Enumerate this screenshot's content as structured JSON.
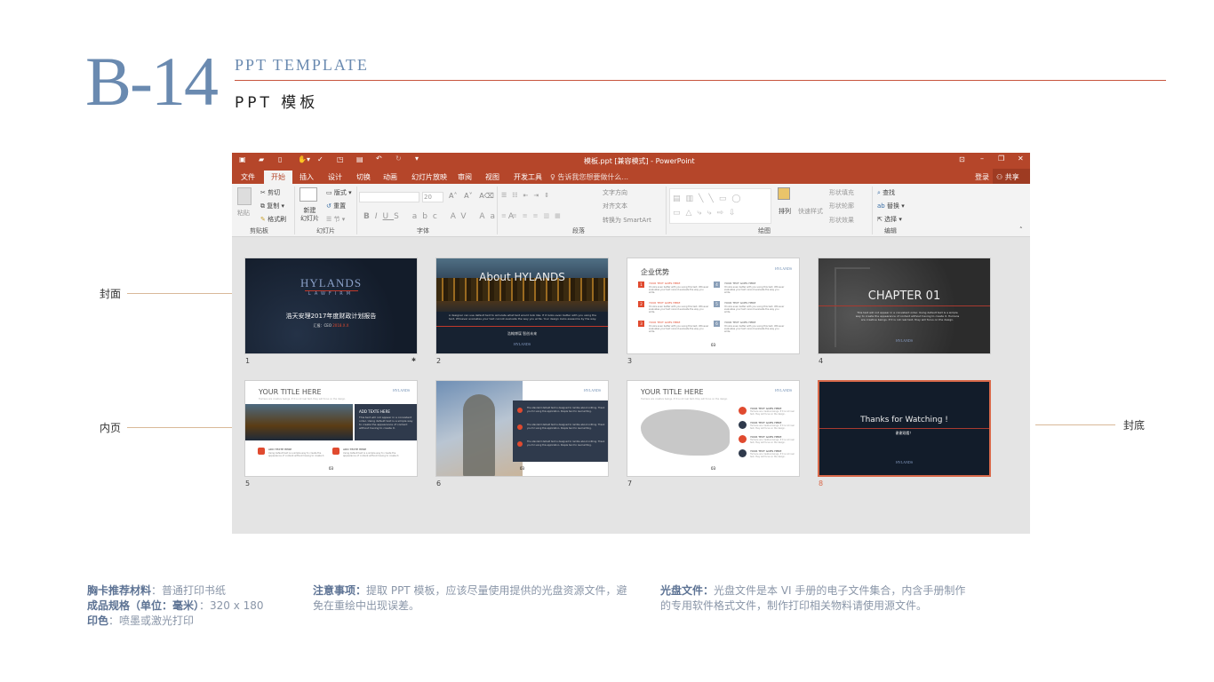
{
  "header": {
    "code": "B-14",
    "title_en": "PPT TEMPLATE",
    "title_cn": "PPT 模板"
  },
  "side_labels": {
    "cover": "封面",
    "inner": "内页",
    "back": "封底"
  },
  "window": {
    "title": "模板.ppt [兼容模式] - PowerPoint",
    "login": "登录",
    "share": "共享",
    "tabs": [
      "文件",
      "开始",
      "插入",
      "设计",
      "切换",
      "动画",
      "幻灯片放映",
      "审阅",
      "视图",
      "开发工具"
    ],
    "active_tab": "开始",
    "tell_me": "告诉我您想要做什么...",
    "ribbon": {
      "paste": "粘贴",
      "cut": "剪切",
      "copy": "复制",
      "format_painter": "格式刷",
      "new_slide": "新建\n幻灯片",
      "layout": "版式",
      "reset": "重置",
      "section": "节",
      "font_size": "20",
      "text_direction": "文字方向",
      "align_text": "对齐文本",
      "smartart": "转换为 SmartArt",
      "arrange": "排列",
      "quick_styles": "快速样式",
      "shape_fill": "形状填充",
      "shape_outline": "形状轮廓",
      "shape_effects": "形状效果",
      "find": "查找",
      "replace": "替换",
      "select": "选择",
      "groups": [
        "剪贴板",
        "幻灯片",
        "字体",
        "段落",
        "绘图",
        "编辑"
      ]
    },
    "accent": "#b5462a"
  },
  "slides": [
    {
      "n": "1",
      "brand": "HYLANDS",
      "sub": "LAWFIRM",
      "title": "浩天安理2017年度财政计划报告",
      "meta": "汇报：CEO",
      "date": "2018.X.X"
    },
    {
      "n": "2",
      "title": "About HYLANDS",
      "body": "A designer can use default text to simulate what text would look like. If it looks even better with you using the text, Whoever evaluates your text cannot evaluate the way you write. Your design looks awesome by the way.",
      "cn": "浩翰博谋 智创未来",
      "brand": "HYLANDS"
    },
    {
      "n": "3",
      "title": "企业优势",
      "brand": "HYLANDS",
      "items": [
        {
          "k": "1",
          "h": "YOUR TEXT GOES HERE"
        },
        {
          "k": "2",
          "h": "YOUR TEXT GOES HERE"
        },
        {
          "k": "3",
          "h": "YOUR TEXT GOES HERE"
        },
        {
          "k": "4",
          "h": "YOUR TEXT GOES HERE"
        },
        {
          "k": "5",
          "h": "YOUR TEXT GOES HERE"
        },
        {
          "k": "6",
          "h": "YOUR TEXT GOES HERE"
        }
      ],
      "body": "It looks even better with you using this text. Whoever evaluates your text cannot evaluate the way you write.",
      "page": "03"
    },
    {
      "n": "4",
      "title": "CHAPTER 01",
      "body": "This text will not appear in a consistent order. Using default text is a simple way to create the appearance of content without having to create it. Humans are creative beings. If it is not real text, they will focus on the design.",
      "brand": "HYLANDS"
    },
    {
      "n": "5",
      "title": "YOUR TITLE HERE",
      "sub": "Humans are creative beings. If it is not real text, they will focus on the design.",
      "box_h": "ADD TEXTE HERE",
      "box_body": "This text will not appear in a consistent order. Using default text is a simple way to create the appearance of content without having to create it.",
      "items": [
        {
          "h": "ADD TEXTE HERE"
        },
        {
          "h": "ADD TEXTE HERE"
        }
      ],
      "item_body": "Using default text is a simple way to create the appearance of content without having to create it.",
      "brand": "HYLANDS",
      "page": "03"
    },
    {
      "n": "6",
      "brand": "HYLANDS",
      "item_body": "The standard default text is designed to ramble about nothing. Thank you for using this application. People tend to read writing.",
      "page": "03"
    },
    {
      "n": "7",
      "title": "YOUR TITLE HERE",
      "sub": "Humans are creative beings. If it is not real text, they will focus on the design.",
      "items": [
        {
          "h": "YOUR TEXT GOES HERE"
        },
        {
          "h": "YOUR TEXT GOES HERE"
        },
        {
          "h": "YOUR TEXT GOES HERE"
        },
        {
          "h": "YOUR TEXT GOES HERE"
        }
      ],
      "item_body": "Humans are creative beings. If it is not real text, they will focus on the design.",
      "brand": "HYLANDS",
      "page": "03"
    },
    {
      "n": "8",
      "title": "Thanks for Watching !",
      "cn": "谢谢观看！",
      "brand": "HYLANDS",
      "selected": true
    }
  ],
  "footer": {
    "col1": [
      {
        "label": "胸卡推荐材料",
        "value": "：普通打印书纸"
      },
      {
        "label": "成品规格（单位：毫米）",
        "value": "：320 x 180"
      },
      {
        "label": "印色",
        "value": "：喷墨或激光打印"
      }
    ],
    "col2": {
      "label": "注意事项：",
      "value": "提取 PPT 模板，应该尽量使用提供的光盘资源文件，避免在重绘中出现误差。"
    },
    "col3": {
      "label": "光盘文件：",
      "value": "光盘文件是本 VI 手册的电子文件集合，内含手册制作的专用软件格式文件，制作打印相关物料请使用源文件。"
    }
  }
}
